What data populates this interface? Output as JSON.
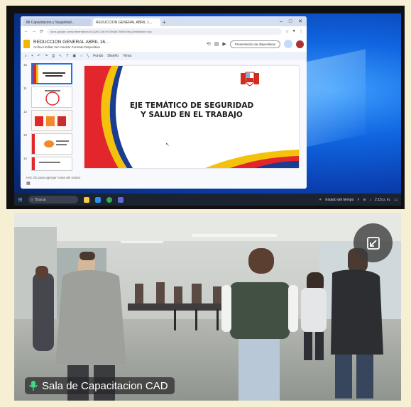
{
  "browser": {
    "tabs": [
      {
        "label": "Mi Capacitacion y Seguridad..."
      },
      {
        "label": "REDUCCION GENERAL ABRIL 1..."
      }
    ],
    "url": "docs.google.com/presentation/d/1A2bC3dE4fG5hI6jK7lM8nO9pQ/edit#slide=id.p"
  },
  "slides": {
    "doc_title": "REDUCCION GENERAL ABRIL 16...",
    "menu": "Archivo  Editar  Ver  Insertar  Formato  Diapositiva",
    "present_label": "Presentación de diapositivas",
    "toolbar": [
      "Fondo",
      "Diseño",
      "Tema"
    ],
    "thumb_numbers": [
      "10",
      "11",
      "12",
      "13",
      "14"
    ],
    "slide_title_line1": "EJE TEMÁTICO DE SEGURIDAD",
    "slide_title_line2": "Y SALUD EN EL TRABAJO",
    "speaker_notes": "Haz clic para agregar notas del orador"
  },
  "taskbar": {
    "search_label": "Buscar",
    "tray_text": "Estado del tiempo",
    "clock": "2:15 p. m."
  },
  "camera": {
    "participant_label": "Sala de Capacitacion CAD",
    "icons": [
      "microphone-icon",
      "exit-fullscreen-icon"
    ]
  },
  "colors": {
    "frame": "#f6efd3",
    "desktop_blue": "#1065e0",
    "accent_red": "#e3262b",
    "accent_yellow": "#f4c20d",
    "accent_blue": "#1a3d8f"
  }
}
